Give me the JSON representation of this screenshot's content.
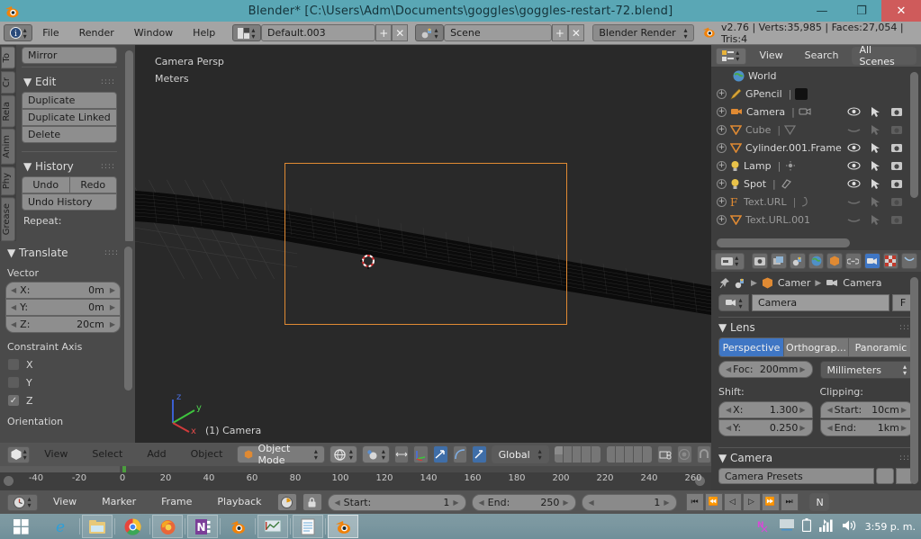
{
  "window": {
    "title": "Blender* [C:\\Users\\Adm\\Documents\\goggles\\goggles-restart-72.blend]",
    "minimize": "—",
    "maximize": "❐",
    "close": "✕"
  },
  "topbar": {
    "menus": [
      "File",
      "Render",
      "Window",
      "Help"
    ],
    "screen_layout": "Default.003",
    "scene": "Scene",
    "engine": "Blender Render",
    "add_label": "+",
    "remove_label": "✕",
    "stats": "v2.76 | Verts:35,985 | Faces:27,054 | Tris:4"
  },
  "toolshelf": {
    "tabs": [
      "To",
      "Cr",
      "Rela",
      "Anim",
      "Phy",
      "Grease"
    ],
    "selected_tab": "To",
    "mirror_label": "Mirror",
    "edit": {
      "title": "Edit",
      "buttons": [
        "Duplicate",
        "Duplicate Linked",
        "Delete"
      ]
    },
    "history": {
      "title": "History",
      "undo": "Undo",
      "redo": "Redo",
      "undo_history": "Undo History",
      "repeat": "Repeat:"
    },
    "translate": {
      "title": "Translate",
      "vector_label": "Vector",
      "fields": [
        {
          "name": "X:",
          "value": "0m"
        },
        {
          "name": "Y:",
          "value": "0m"
        },
        {
          "name": "Z:",
          "value": "20cm"
        }
      ],
      "constraint_label": "Constraint Axis",
      "axes": [
        {
          "label": "X",
          "checked": false
        },
        {
          "label": "Y",
          "checked": false
        },
        {
          "label": "Z",
          "checked": true
        }
      ],
      "orientation_label": "Orientation"
    }
  },
  "viewport": {
    "view_name": "Camera Persp",
    "unit": "Meters",
    "scene_object": "(1) Camera",
    "gizmo_axes": [
      "z",
      "y",
      "x"
    ],
    "colors": {
      "background": "#323232",
      "camera_frame": "#e08a33",
      "axis_x": "#d13b3b",
      "axis_y": "#3ec43e",
      "axis_z": "#3b5fd1"
    }
  },
  "viewport_footer": {
    "menus": [
      "View",
      "Select",
      "Add",
      "Object"
    ],
    "mode": "Object Mode",
    "orientation": "Global"
  },
  "ruler": {
    "ticks": [
      "-40",
      "-20",
      "0",
      "20",
      "40",
      "60",
      "80",
      "100",
      "120",
      "140",
      "160",
      "180",
      "200",
      "220",
      "240",
      "260"
    ],
    "playhead_value": "0"
  },
  "timeline": {
    "menus": [
      "View",
      "Marker",
      "Frame",
      "Playback"
    ],
    "start_label": "Start:",
    "start_value": "1",
    "end_label": "End:",
    "end_value": "250",
    "current_frame": "1",
    "transport": [
      "⏮",
      "⏪",
      "◁",
      "▷",
      "⏩",
      "⏭"
    ],
    "new_button": "N"
  },
  "outliner": {
    "menus": [
      "View",
      "Search"
    ],
    "scope": "All Scenes",
    "rows": [
      {
        "name": "World",
        "icon": "world-icon",
        "expandable": false,
        "visible": null,
        "dim": false
      },
      {
        "name": "GPencil",
        "icon": "pencil-icon",
        "expandable": true,
        "visible": null,
        "dim": false
      },
      {
        "name": "Camera",
        "icon": "camera-icon",
        "expandable": true,
        "visible": true,
        "dim": false
      },
      {
        "name": "Cube",
        "icon": "mesh-icon",
        "expandable": true,
        "visible": false,
        "dim": true
      },
      {
        "name": "Cylinder.001.Frame",
        "icon": "mesh-icon",
        "expandable": true,
        "visible": true,
        "dim": false
      },
      {
        "name": "Lamp",
        "icon": "lamp-icon",
        "expandable": true,
        "visible": true,
        "dim": false
      },
      {
        "name": "Spot",
        "icon": "lamp-icon",
        "expandable": true,
        "visible": true,
        "dim": false
      },
      {
        "name": "Text.URL",
        "icon": "font-icon",
        "expandable": true,
        "visible": false,
        "dim": true
      },
      {
        "name": "Text.URL.001",
        "icon": "mesh-icon",
        "expandable": true,
        "visible": false,
        "dim": true
      }
    ]
  },
  "properties": {
    "tab_icons": [
      "render-icon",
      "render-layers-icon",
      "scene-icon",
      "world-icon",
      "object-icon",
      "constraints-icon",
      "camera-data-icon",
      "texture-icon",
      "particles-icon"
    ],
    "selected_tab_index": 6,
    "breadcrumb": [
      "Camer",
      "Camera"
    ],
    "datablock_name": "Camera",
    "fake_user": "F",
    "lens": {
      "title": "Lens",
      "types": [
        "Perspective",
        "Orthograp...",
        "Panoramic"
      ],
      "selected_type": "Perspective",
      "focal_label": "Foc:",
      "focal_value": "200mm",
      "unit": "Millimeters",
      "shift_label": "Shift:",
      "shift": [
        {
          "name": "X:",
          "value": "1.300"
        },
        {
          "name": "Y:",
          "value": "0.250"
        }
      ],
      "clipping_label": "Clipping:",
      "clipping": [
        {
          "name": "Start:",
          "value": "10cm"
        },
        {
          "name": "End:",
          "value": "1km"
        }
      ]
    },
    "camera_panel": {
      "title": "Camera",
      "presets_label": "Camera Presets"
    }
  },
  "taskbar": {
    "start": "start-icon",
    "apps": [
      "internet-explorer-icon",
      "file-explorer-icon",
      "chrome-icon",
      "firefox-icon",
      "onenote-icon",
      "blender-icon",
      "graph-icon",
      "notepad-icon",
      "blender-active-icon"
    ],
    "tray_icons": [
      "onenote-clipper-icon",
      "keyboard-icon",
      "battery-icon",
      "network-icon",
      "volume-icon"
    ],
    "clock": "3:59 p. m."
  }
}
